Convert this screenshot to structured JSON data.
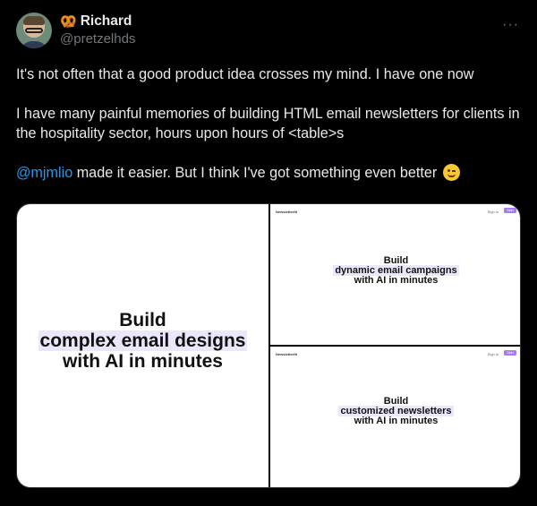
{
  "author": {
    "display_name": "Richard",
    "name_emoji": "🥨",
    "handle": "@pretzelhds",
    "avatar_icon": "avatar-icon"
  },
  "more_label": "···",
  "tweet": {
    "line1": "It's not often that a good product idea crosses my mind. I have one now",
    "line2": "I have many painful memories of building HTML email newsletters for clients in the hospitality sector, hours upon hours of <table>s",
    "mention": "@mjmlio",
    "line3_rest": " made it easier. But I think I've got something even better",
    "emoji_icon": "winking-face-icon"
  },
  "media": {
    "left": {
      "word": "Build",
      "highlight": "complex email designs",
      "tail": "with AI in minutes"
    },
    "top_right": {
      "word": "Build",
      "highlight": "dynamic email campaigns",
      "tail": "with AI in minutes",
      "logo": "Newsletterfit",
      "signin": "Sign in",
      "cta": "Start free"
    },
    "bottom_right": {
      "word": "Build",
      "highlight": "customized newsletters",
      "tail": "with AI in minutes",
      "logo": "Newsletterfit",
      "signin": "Sign in",
      "cta": "Start free"
    }
  },
  "colors": {
    "background": "#000000",
    "text": "#e7e9ea",
    "secondary": "#71767b",
    "mention": "#1d9bf0",
    "highlight": "#ece6fb",
    "cta": "#a27cf0"
  }
}
